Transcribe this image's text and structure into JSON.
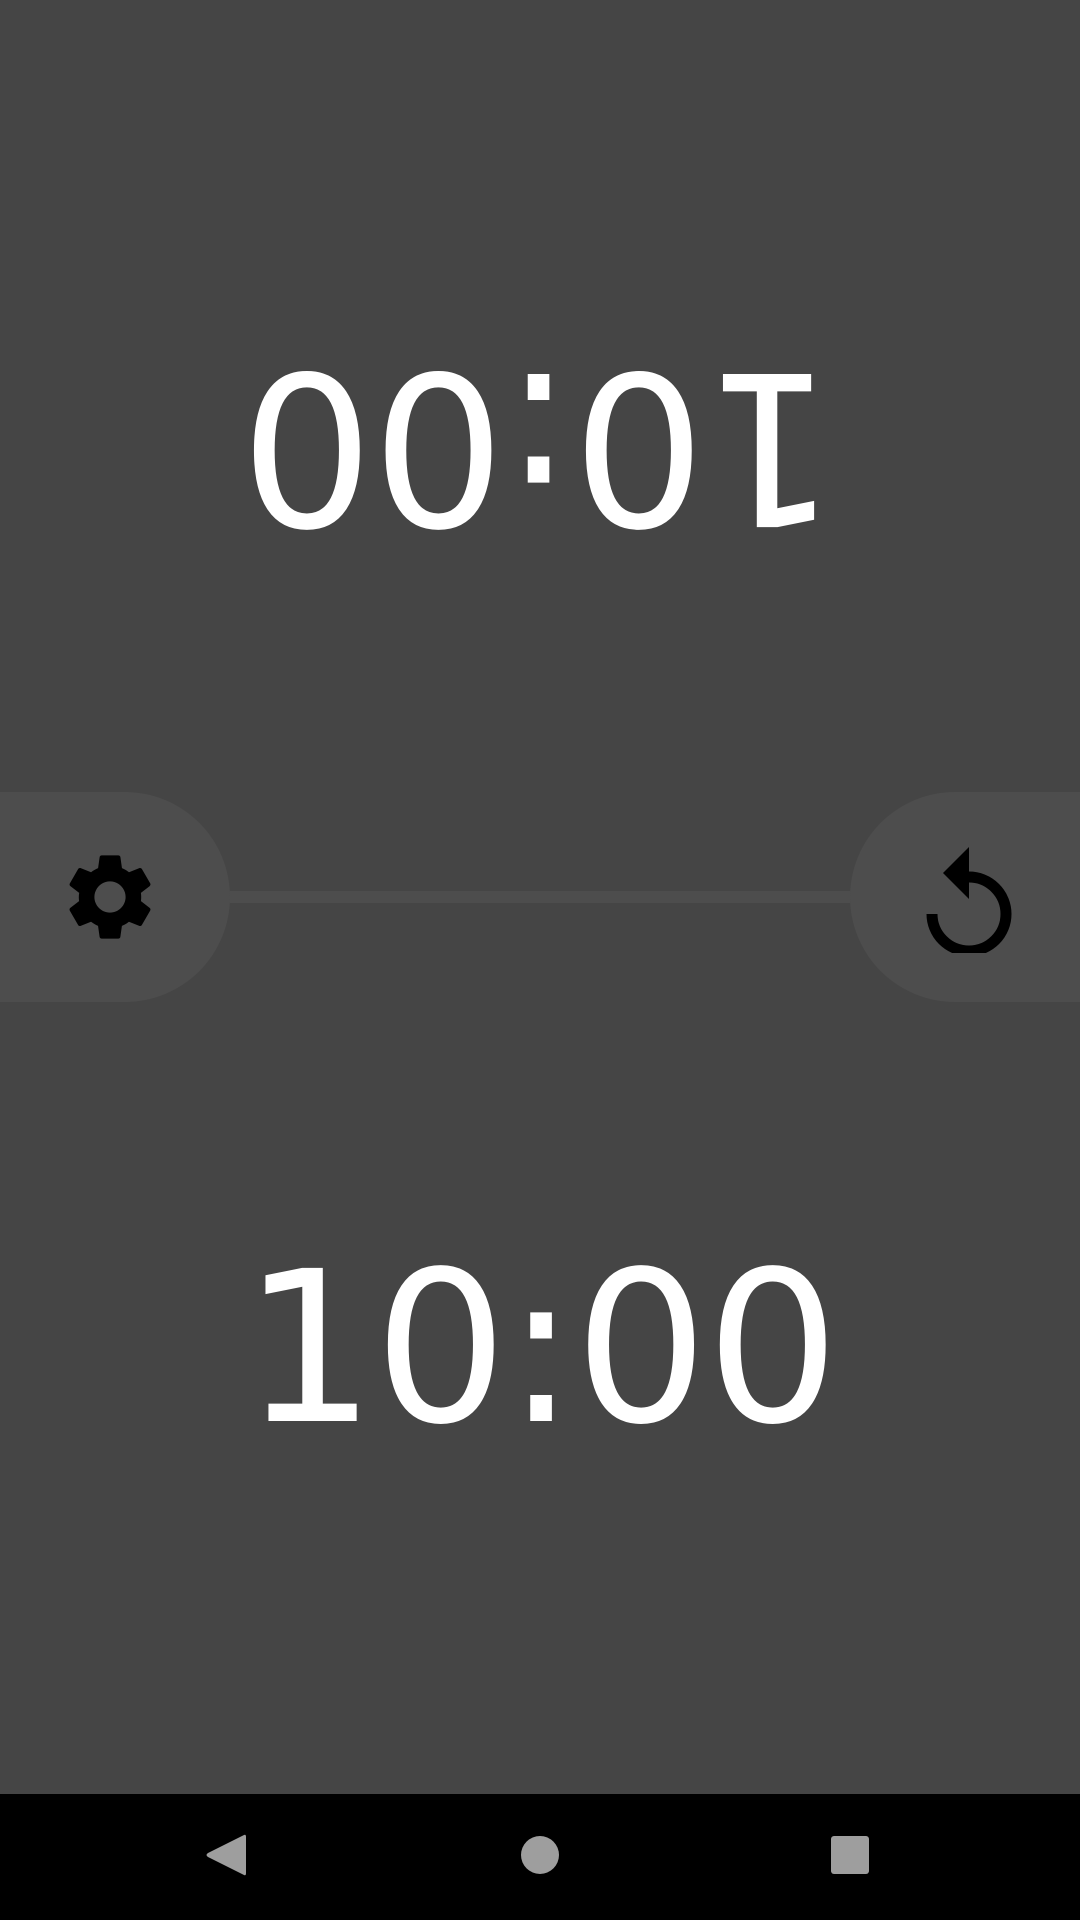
{
  "clocks": {
    "top_player": {
      "time": "10:00"
    },
    "bottom_player": {
      "time": "10:00"
    }
  },
  "controls": {
    "settings_icon": "gear-icon",
    "reset_icon": "reset-icon"
  },
  "navigation": {
    "back_icon": "back-triangle-icon",
    "home_icon": "home-circle-icon",
    "recents_icon": "recents-square-icon"
  },
  "colors": {
    "background": "#454545",
    "divider": "#4d4d4d",
    "clock_text": "#ffffff",
    "nav_bar": "#000000",
    "nav_icons": "#9e9e9e"
  }
}
